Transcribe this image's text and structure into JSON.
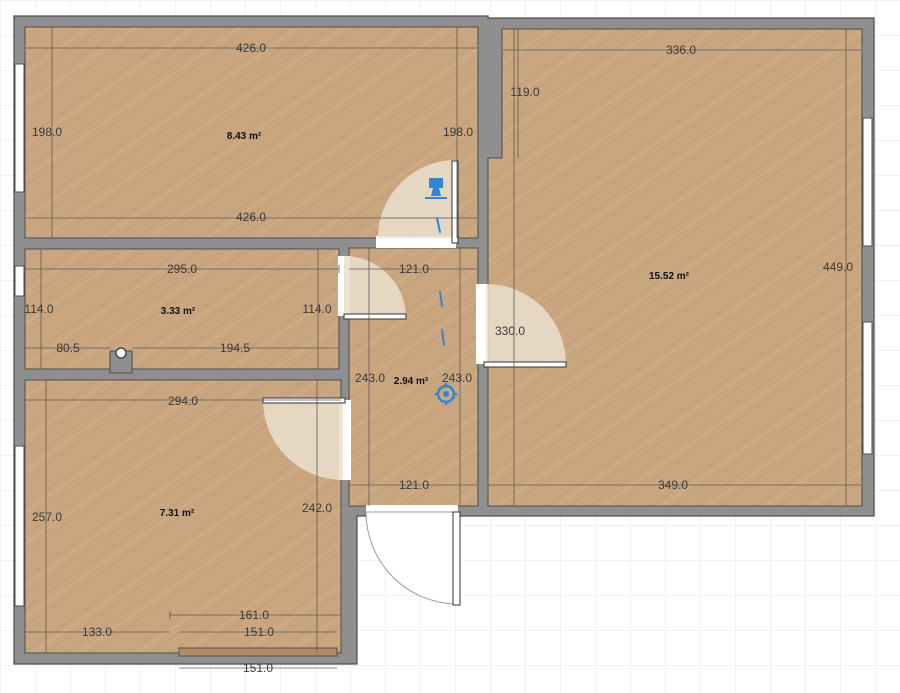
{
  "colors": {
    "background": "#ffffff",
    "grid": "#dde4ea",
    "floor": "#c9a67f",
    "floor_grain": "#b8946c",
    "wall": "#8f8f8f",
    "wall_edge": "#4d4d4d",
    "door_swing": "#eadfce",
    "camera": "#2f86d6"
  },
  "rooms": [
    {
      "id": "room-top-left",
      "area": "8.43 m²"
    },
    {
      "id": "room-right",
      "area": "15.52 m²"
    },
    {
      "id": "room-small",
      "area": "3.33 m²"
    },
    {
      "id": "room-hall",
      "area": "2.94 m²"
    },
    {
      "id": "room-bottom-left",
      "area": "7.31 m²"
    }
  ],
  "dimensions": {
    "top_left_width": "426.0",
    "top_left_height_left": "198.0",
    "top_left_height_right": "198.0",
    "top_left_width_bottom": "426.0",
    "right_width": "336.0",
    "right_upper_offset": "119.0",
    "right_height": "449.0",
    "right_inner": "330.0",
    "right_width_bottom": "349.0",
    "small_width": "295.0",
    "small_height_left": "114.0",
    "small_height_right": "114.0",
    "small_seg_a": "80.5",
    "small_seg_b": "194.5",
    "hall_width_top": "121.0",
    "hall_height_left": "243.0",
    "hall_height_right": "243.0",
    "hall_width_bottom": "121.0",
    "bottom_left_width": "294.0",
    "bottom_left_height_left": "257.0",
    "bottom_left_height_right": "242.0",
    "bottom_seg_a": "161.0",
    "bottom_seg_b": "133.0",
    "bottom_seg_c": "151.0",
    "bottom_seg_d": "151.0"
  },
  "icons": {
    "camera_top": "camera-icon",
    "observer": "observer-icon",
    "column": "column-icon"
  }
}
